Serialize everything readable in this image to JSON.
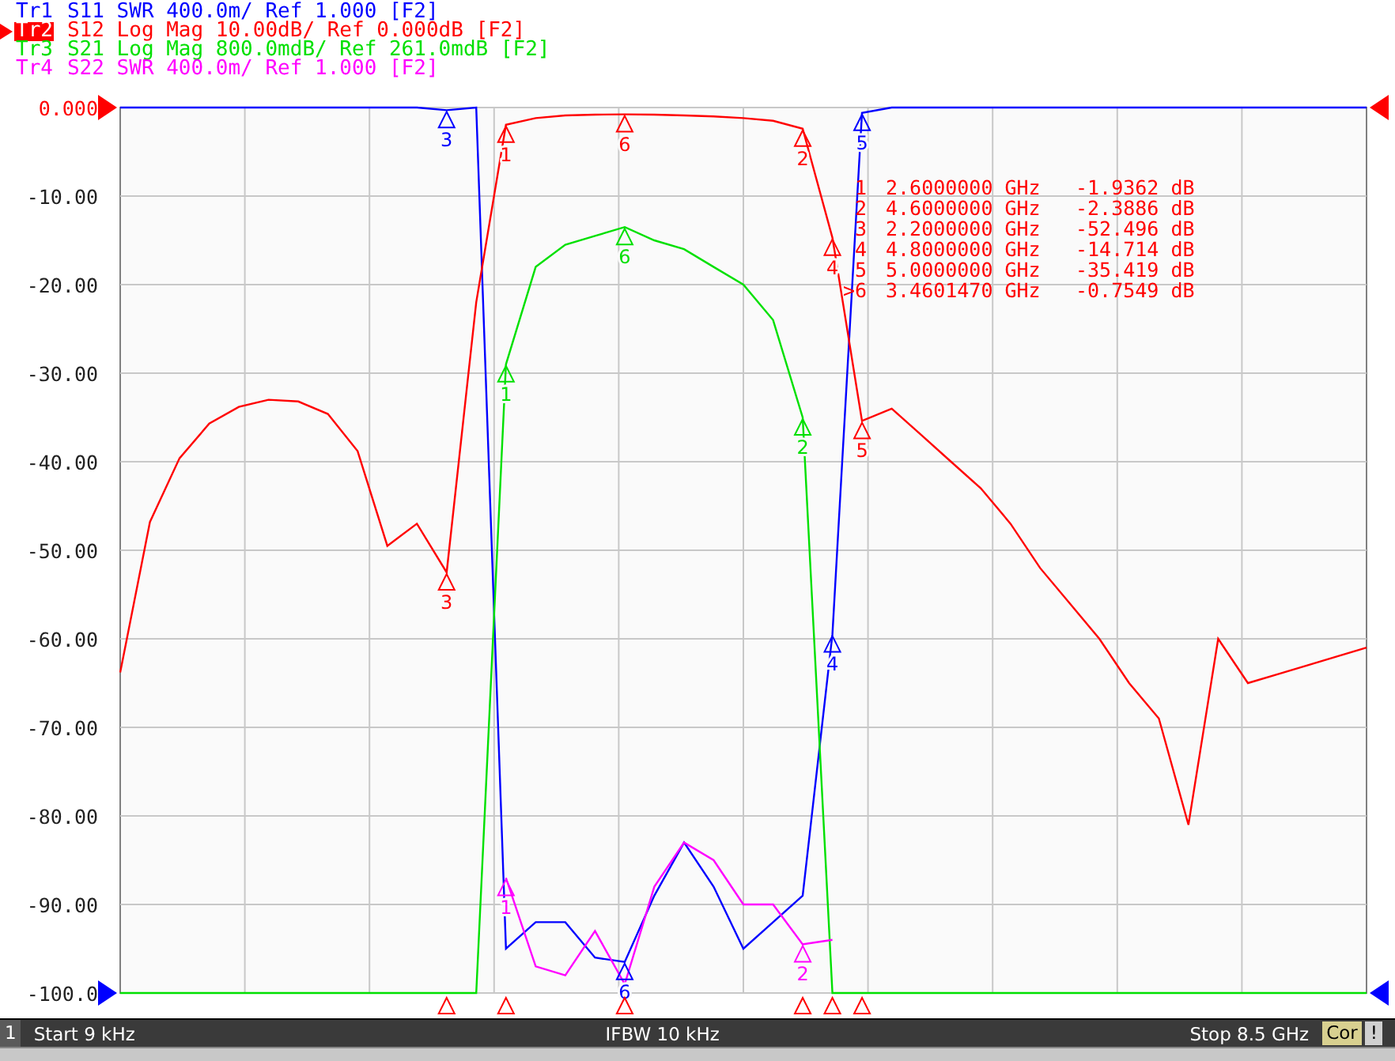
{
  "traces": [
    {
      "setting": "S11 SWR 400.0m/ Ref 1.000 [F2]",
      "selected": false
    },
    {
      "setting": "S12 Log Mag 10.00dB/ Ref 0.000dB [F2]",
      "selected": true
    },
    {
      "setting": "S21 Log Mag 800.0mdB/ Ref 261.0mdB [F2]",
      "selected": false
    },
    {
      "setting": "S22 SWR 400.0m/ Ref 1.000 [F2]",
      "selected": false
    }
  ],
  "chart_data": {
    "type": "line",
    "grid": true,
    "ylim": [
      -100,
      0
    ],
    "yticks": [
      {
        "value": 0,
        "label": "0.000"
      },
      {
        "value": -10,
        "label": "-10.00"
      },
      {
        "value": -20,
        "label": "-20.00"
      },
      {
        "value": -30,
        "label": "-30.00"
      },
      {
        "value": -40,
        "label": "-40.00"
      },
      {
        "value": -50,
        "label": "-50.00"
      },
      {
        "value": -60,
        "label": "-60.00"
      },
      {
        "value": -70,
        "label": "-70.00"
      },
      {
        "value": -80,
        "label": "-80.00"
      },
      {
        "value": -90,
        "label": "-90.00"
      },
      {
        "value": -100,
        "label": "-100.0"
      }
    ],
    "categories": [
      null,
      null,
      null,
      null,
      null,
      null,
      null,
      null,
      null,
      null,
      null,
      null,
      null,
      null,
      null,
      null,
      null,
      null,
      null,
      null,
      null,
      null,
      null,
      null,
      null,
      null,
      null,
      null,
      null,
      null,
      null,
      null,
      null,
      null,
      null,
      null,
      null,
      null,
      null,
      null,
      null,
      null,
      null
    ],
    "series": [
      {
        "name": "Tr1",
        "color": "#0000ff",
        "values": [
          0,
          0,
          0,
          0,
          0,
          0,
          0,
          0,
          0,
          0,
          0,
          -0.3,
          0,
          -95,
          -92,
          -92,
          -96,
          -96.5,
          -89,
          -83,
          -88,
          -95,
          -92,
          -89,
          -59.5,
          -0.6,
          0,
          0,
          0,
          0,
          0,
          0,
          0,
          0,
          0,
          0,
          0,
          0,
          0,
          0,
          0,
          0,
          0
        ]
      },
      {
        "name": "Tr2",
        "color": "#ff0000",
        "values": [
          -63.8,
          -46.8,
          -39.6,
          -35.7,
          -33.8,
          -33,
          -33.2,
          -34.6,
          -38.8,
          -49.5,
          -47,
          -52.5,
          -22,
          -1.94,
          -1.2,
          -0.9,
          -0.8,
          -0.76,
          -0.8,
          -0.9,
          -1,
          -1.2,
          -1.5,
          -2.39,
          -14.7,
          -35.4,
          -34,
          -37,
          -40,
          -43,
          -47,
          -52,
          -56,
          -60,
          -65,
          -69,
          -81,
          -60,
          -65,
          -64,
          -63,
          -62,
          -61
        ]
      },
      {
        "name": "Tr3",
        "color": "#00e000",
        "values": [
          -100,
          -100,
          -100,
          -100,
          -100,
          -100,
          -100,
          -100,
          -100,
          -100,
          -100,
          -100,
          -100,
          -29,
          -18,
          -15.5,
          -14.5,
          -13.5,
          -15,
          -16,
          -18,
          -20,
          -24,
          -35,
          -100,
          -100,
          -100,
          -100,
          -100,
          -100,
          -100,
          -100,
          -100,
          -100,
          -100,
          -100,
          -100,
          -100,
          -100,
          -100,
          -100,
          -100,
          -100
        ]
      },
      {
        "name": "Tr4",
        "color": "#ff00ff",
        "values": [
          null,
          null,
          null,
          null,
          null,
          null,
          null,
          null,
          null,
          null,
          null,
          null,
          null,
          -87,
          -97,
          -98,
          -93,
          -99,
          -88,
          -83,
          -85,
          -90,
          -90,
          -94.5,
          -94,
          null,
          null,
          null,
          null,
          null,
          null,
          null,
          null,
          null,
          null,
          null,
          null,
          null,
          null,
          null,
          null,
          null,
          null
        ]
      }
    ],
    "annotations": [
      {
        "y": -1.94,
        "text": "1"
      },
      {
        "y": -2.39,
        "text": "2"
      },
      {
        "y": -52.5,
        "text": "3"
      },
      {
        "y": -14.7,
        "text": "4"
      },
      {
        "y": -35.4,
        "text": "5"
      },
      {
        "y": -0.76,
        "text": "6"
      },
      {
        "y": -29,
        "text": "1"
      },
      {
        "y": -35,
        "text": "2"
      },
      {
        "y": -13.5,
        "text": "6"
      },
      {
        "y": -0.3,
        "text": "3"
      },
      {
        "y": -0.6,
        "text": "5"
      },
      {
        "y": -59.5,
        "text": "4"
      },
      {
        "y": -96.5,
        "text": "6"
      },
      {
        "y": -87,
        "text": "1"
      },
      {
        "y": -94.5,
        "text": "2"
      }
    ]
  },
  "marker_table": [
    {
      "label": "1",
      "frequency": "2.6000000 GHz",
      "value": "-1.9362 dB"
    },
    {
      "label": "2",
      "frequency": "4.6000000 GHz",
      "value": "-2.3886 dB"
    },
    {
      "label": "3",
      "frequency": "2.2000000 GHz",
      "value": "-52.496 dB"
    },
    {
      "label": "4",
      "frequency": "4.8000000 GHz",
      "value": "-14.714 dB"
    },
    {
      "label": "5",
      "frequency": "5.0000000 GHz",
      "value": "-35.419 dB"
    },
    {
      "label": ">6",
      "frequency": "3.4601470 GHz",
      "value": "-0.7549 dB"
    }
  ],
  "status_bar": {
    "channel": "1",
    "start": "Start 9 kHz",
    "ifbw": "IFBW 10 kHz",
    "stop": "Stop 8.5 GHz",
    "correction": "Cor",
    "warning": "!"
  }
}
